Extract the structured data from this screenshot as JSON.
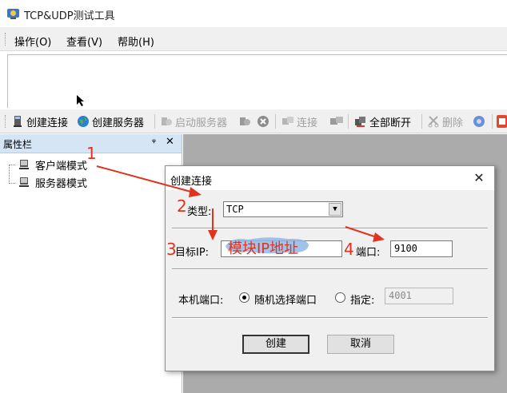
{
  "window": {
    "title": "TCP&UDP测试工具",
    "icon": "network-app-icon"
  },
  "menu": {
    "items": [
      "操作(O)",
      "查看(V)",
      "帮助(H)"
    ]
  },
  "toolbar": {
    "create_connection": "创建连接",
    "create_server": "创建服务器",
    "start_server": "启动服务器",
    "connect": "连接",
    "disconnect_all": "全部断开",
    "delete": "删除"
  },
  "property_panel": {
    "title": "属性栏",
    "pin": "ᵠ",
    "close": "✕",
    "items": [
      "客户端模式",
      "服务器模式"
    ]
  },
  "dialog": {
    "title": "创建连接",
    "close": "✕",
    "type_label": "类型:",
    "type_value": "TCP",
    "target_ip_label": "目标IP:",
    "target_ip_value": "",
    "port_label": "端口:",
    "port_value": "9100",
    "local_port_label": "本机端口:",
    "random_port_label": "随机选择端口",
    "specify_label": "指定:",
    "specify_value": "4001",
    "create_button": "创建",
    "cancel_button": "取消"
  },
  "annotations": {
    "n1": "1",
    "n2": "2",
    "n3": "3",
    "n4": "4",
    "module_ip": "模块IP地址",
    "color": "#e0321d"
  }
}
